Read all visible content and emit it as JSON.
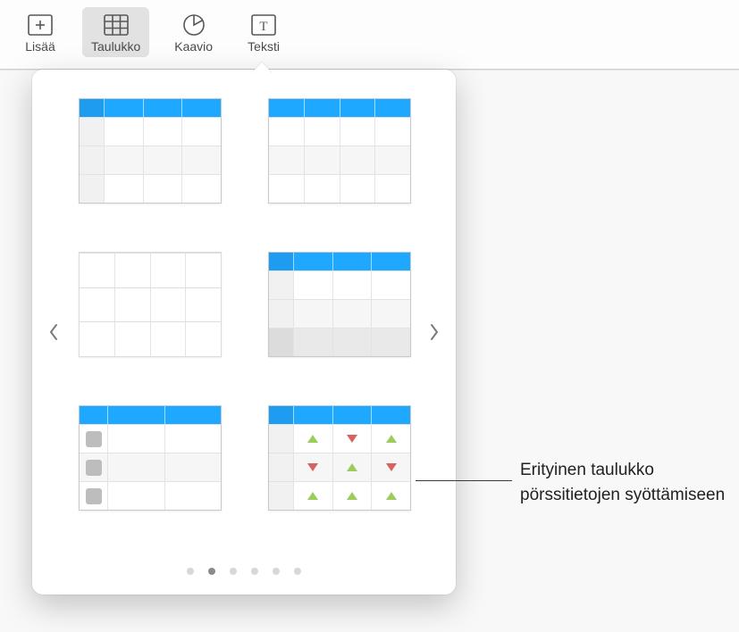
{
  "toolbar": {
    "items": [
      {
        "label": "Lisää",
        "icon": "insert-icon"
      },
      {
        "label": "Taulukko",
        "icon": "table-icon",
        "active": true
      },
      {
        "label": "Kaavio",
        "icon": "chart-icon"
      },
      {
        "label": "Teksti",
        "icon": "text-icon"
      }
    ]
  },
  "popover": {
    "thumbnails": [
      {
        "name": "table-style-header-rowcol",
        "description": "Blue header row with row header column"
      },
      {
        "name": "table-style-header-only",
        "description": "Blue header row only"
      },
      {
        "name": "table-style-plain",
        "description": "Plain grid no header"
      },
      {
        "name": "table-style-header-footer",
        "description": "Header row, row header, footer row"
      },
      {
        "name": "table-style-checklist",
        "description": "Header with checkbox row headers"
      },
      {
        "name": "table-style-stock",
        "description": "Stock data table with up/down indicators"
      }
    ],
    "page_dots": {
      "count": 6,
      "active_index": 1
    }
  },
  "callout": {
    "text": "Erityinen taulukko pörssitietojen syöttämiseen"
  }
}
